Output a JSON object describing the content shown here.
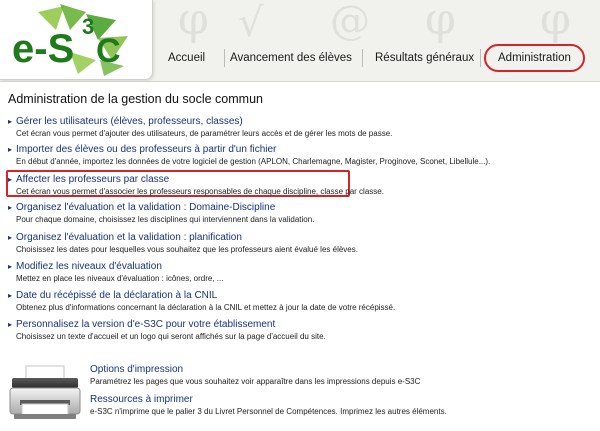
{
  "logo": {
    "text_e": "e-S",
    "sup": "3",
    "text_c": "C"
  },
  "nav": {
    "items": [
      {
        "label": "Accueil"
      },
      {
        "label": "Avancement des élèves"
      },
      {
        "label": "Résultats généraux"
      },
      {
        "label": "Administration",
        "active": true
      }
    ]
  },
  "page_title": "Administration de la gestion du socle commun",
  "entries": [
    {
      "title": "Gérer les utilisateurs (élèves, professeurs, classes)",
      "desc": "Cet écran vous permet d'ajouter des utilisateurs, de paramétrer leurs accès et de gérer les mots de passe."
    },
    {
      "title": "Importer des élèves ou des professeurs à partir d'un fichier",
      "desc": "En début d'année, importez les données de votre logiciel de gestion (APLON, Charlemagne, Magister, Proginove, Sconet, Libellule...)."
    },
    {
      "title": "Affecter les professeurs par classe",
      "desc": "Cet écran vous permet d'associer les professeurs responsables de chaque discipline, classe par classe."
    },
    {
      "title": "Organisez l'évaluation et la validation : Domaine-Discipline",
      "desc": "Pour chaque domaine, choisissez les disciplines qui interviennent dans la validation."
    },
    {
      "title": "Organisez l'évaluation et la validation : planification",
      "desc": "Choisissez les dates pour lesquelles vous souhaitez que les professeurs aient évalué les élèves."
    },
    {
      "title": "Modifiez les niveaux d'évaluation",
      "desc": "Mettez en place les niveaux d'évaluation : icônes, ordre, ..."
    },
    {
      "title": "Date du récépissé de la déclaration à la CNIL",
      "desc": "Obtenez plus d'informations concernant la déclaration à la CNIL et mettez à jour la date de votre récépissé."
    },
    {
      "title": "Personnalisez la version d'e-S3C pour votre établissement",
      "desc": "Choisissez un texte d'accueil et un logo qui seront affichés sur la page d'accueil du site."
    }
  ],
  "print_options": {
    "title": "Options d'impression",
    "desc": "Paramétrez les pages que vous souhaitez voir apparaître dans les impressions depuis e-S3C"
  },
  "print_resources": {
    "title": "Ressources à imprimer",
    "desc": "e-S3C n'imprime que le palier 3 du Livret Personnel de Compétences. Imprimez les autres éléments."
  },
  "colors": {
    "link": "#16337e",
    "highlight": "#d4242a",
    "logo_green": "#49a32b"
  },
  "icons": {
    "entry_arrow": "triangle-right-icon",
    "printer": "printer-icon"
  }
}
